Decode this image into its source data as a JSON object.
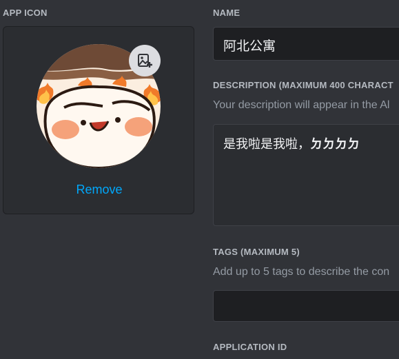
{
  "app_icon": {
    "label": "APP ICON",
    "remove_label": "Remove",
    "upload_icon": "image-add-icon"
  },
  "name": {
    "label": "NAME",
    "value": "阿北公寓"
  },
  "description": {
    "label": "DESCRIPTION (MAXIMUM 400 CHARACT",
    "helper": "Your description will appear in the Al",
    "value_normal": "是我啦是我啦，",
    "value_bold": "ㄉㄉㄉㄉ"
  },
  "tags": {
    "label": "TAGS (MAXIMUM 5)",
    "helper": "Add up to 5 tags to describe the con",
    "value": ""
  },
  "application_id": {
    "label": "APPLICATION ID"
  },
  "colors": {
    "background": "#313338",
    "card": "#2b2d31",
    "input": "#1e1f22",
    "link": "#00a8fc"
  }
}
